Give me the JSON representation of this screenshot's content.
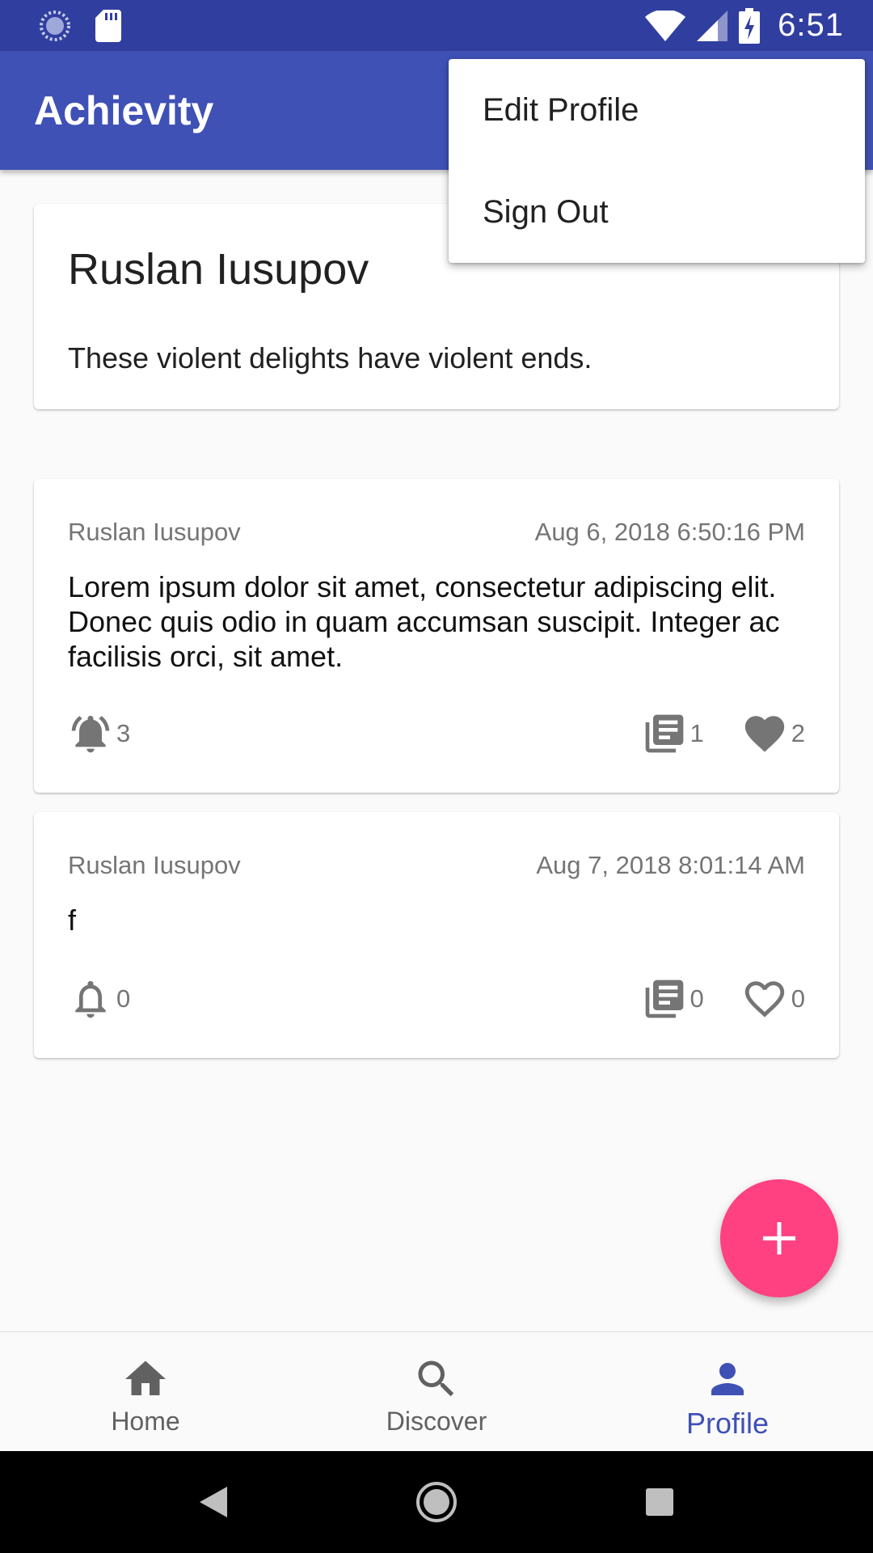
{
  "status_bar": {
    "time": "6:51",
    "icons": [
      "loading-icon",
      "sd-card-icon",
      "wifi-icon",
      "signal-icon",
      "battery-charging-icon"
    ]
  },
  "app_bar": {
    "title": "Achievity"
  },
  "menu": {
    "items": [
      {
        "label": "Edit Profile"
      },
      {
        "label": "Sign Out"
      }
    ]
  },
  "profile": {
    "name": "Ruslan Iusupov",
    "bio": "These violent delights have violent ends."
  },
  "posts": [
    {
      "author": "Ruslan Iusupov",
      "timestamp": "Aug 6, 2018 6:50:16 PM",
      "body": "Lorem ipsum dolor sit amet, consectetur adipiscing elit. Donec quis odio in quam accumsan suscipit. Integer ac facilisis orci, sit amet.",
      "notifications": "3",
      "notifications_icon": "bell-ringing-icon",
      "comments": "1",
      "likes": "2",
      "likes_icon": "heart-filled-icon"
    },
    {
      "author": "Ruslan Iusupov",
      "timestamp": "Aug 7, 2018 8:01:14 AM",
      "body": "f",
      "notifications": "0",
      "notifications_icon": "bell-outline-icon",
      "comments": "0",
      "likes": "0",
      "likes_icon": "heart-outline-icon"
    }
  ],
  "fab": {
    "icon": "plus-icon"
  },
  "bottom_nav": {
    "items": [
      {
        "label": "Home",
        "icon": "home-icon",
        "active": false
      },
      {
        "label": "Discover",
        "icon": "search-icon",
        "active": false
      },
      {
        "label": "Profile",
        "icon": "person-icon",
        "active": true
      }
    ]
  },
  "colors": {
    "primary": "#3f51b5",
    "primary_dark": "#303f9f",
    "accent": "#ff4081",
    "icon_grey": "#757575"
  }
}
